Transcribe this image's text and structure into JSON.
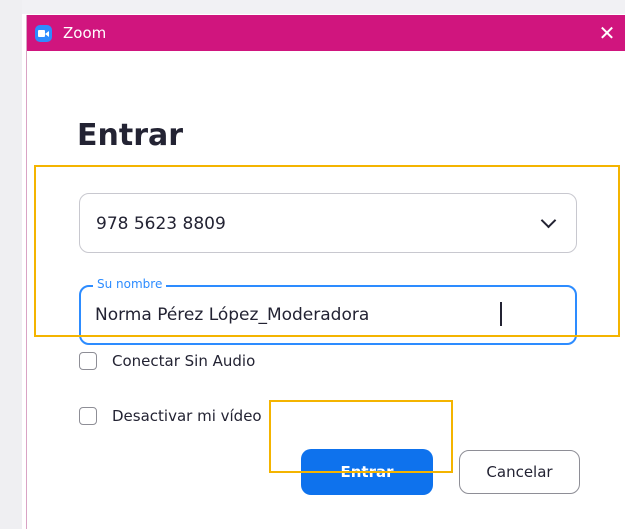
{
  "window": {
    "title": "Zoom",
    "app_icon": "zoom-video-icon",
    "close_icon": "close-icon",
    "close_glyph": "✕",
    "titlebar_color": "#d0157e"
  },
  "dialog": {
    "heading": "Entrar",
    "meeting_id": {
      "value": "978 5623 8809",
      "icon": "chevron-down-icon"
    },
    "name_field": {
      "label": "Su nombre",
      "value": "Norma Pérez López_Moderadora",
      "focus_color": "#2d8cff"
    },
    "options": [
      {
        "label": "Conectar Sin Audio",
        "checked": false
      },
      {
        "label": "Desactivar mi vídeo",
        "checked": false
      }
    ],
    "buttons": {
      "join": "Entrar",
      "cancel": "Cancelar"
    },
    "primary_color": "#0e72ed"
  },
  "annotations": {
    "highlight_color": "#f4b400"
  }
}
